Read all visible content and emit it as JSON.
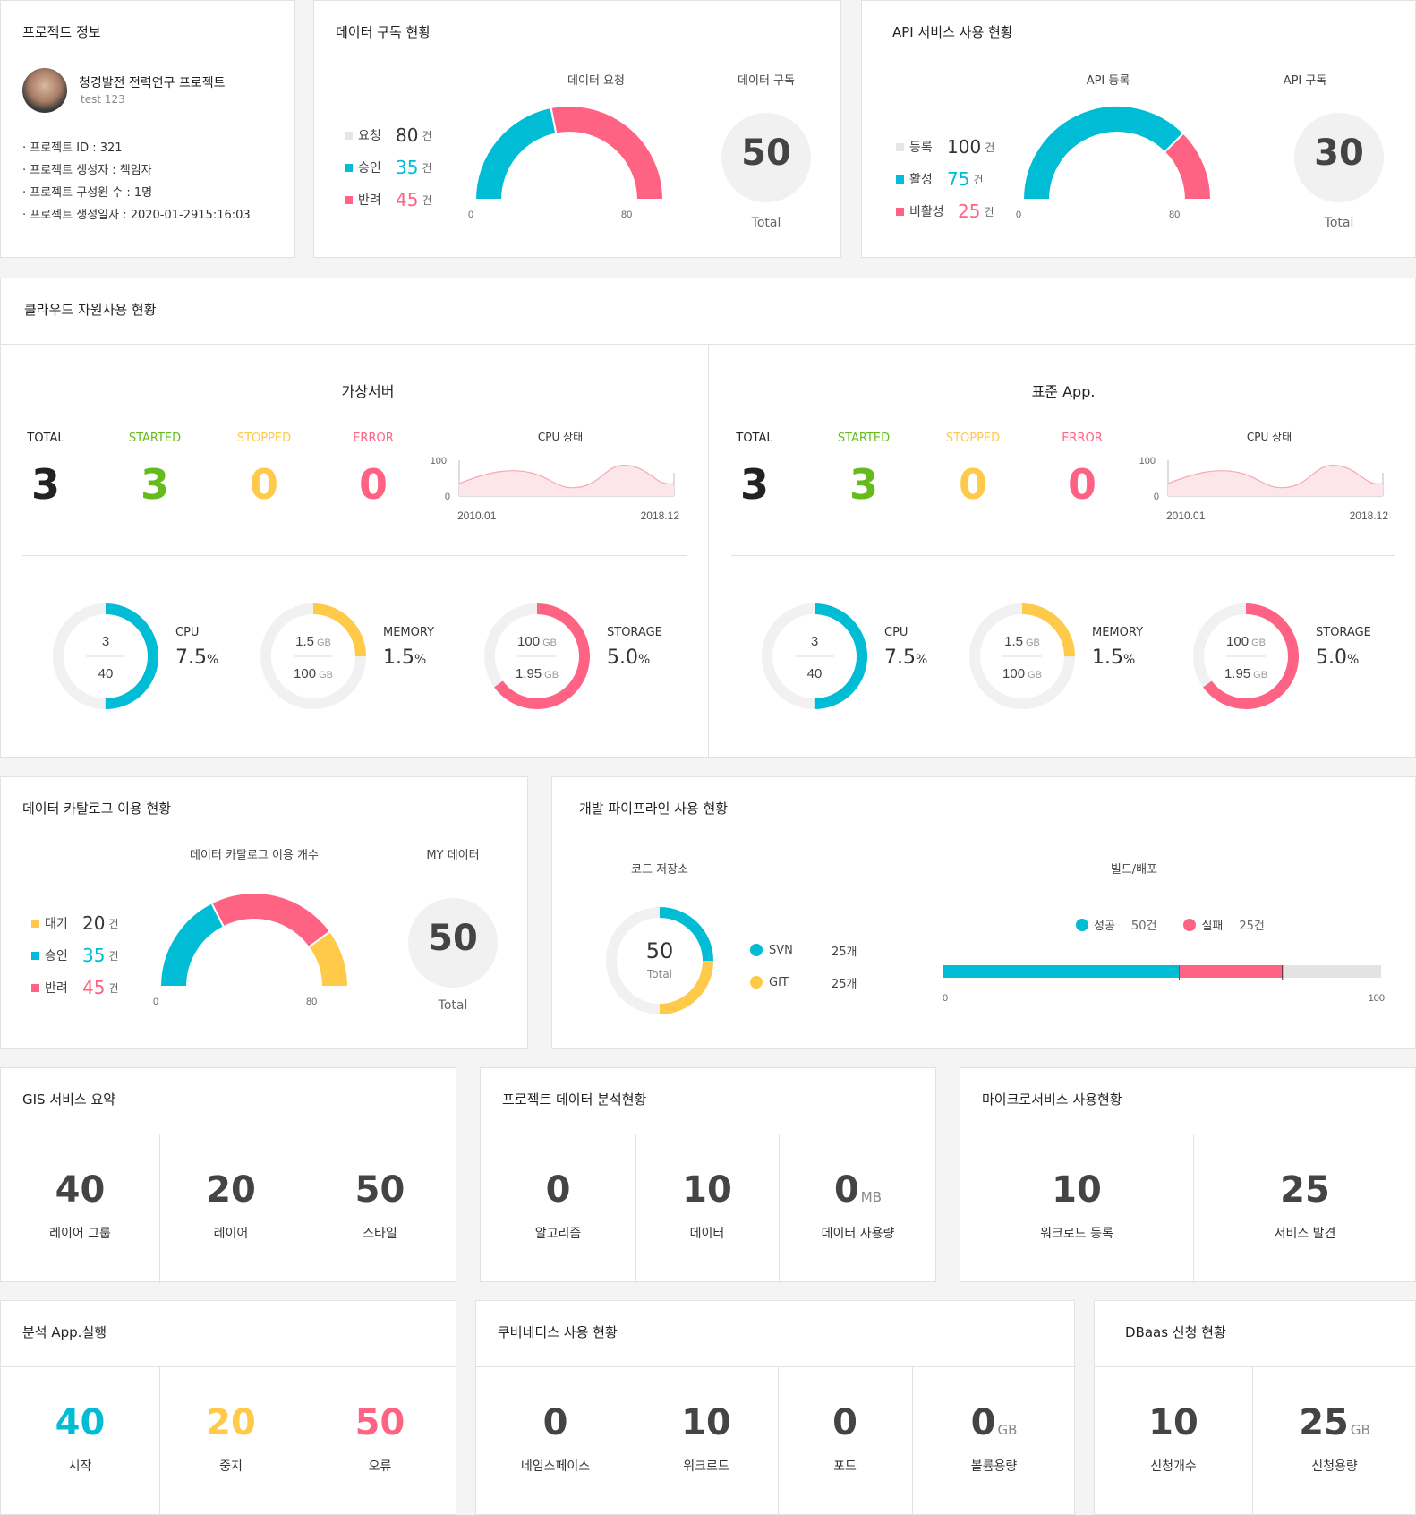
{
  "project": {
    "title": "프로젝트 정보",
    "name": "청경발전 전력연구 프로젝트",
    "sub": "test 123",
    "details": [
      "· 프로젝트 ID :  321",
      "· 프로젝트 생성자 : 책임자",
      "· 프로젝트 구성원 수 : 1명",
      "· 프로젝트 생성일자 :  2020-01-2915:16:03"
    ]
  },
  "data_sub": {
    "title": "데이터 구독 현황",
    "chart_label": "데이터 요청",
    "total_label": "데이터 구독",
    "total_value": "50",
    "total_caption": "Total",
    "legend": [
      {
        "label": "요청",
        "value": "80",
        "unit": "건",
        "color": "#e6e6e6"
      },
      {
        "label": "승인",
        "value": "35",
        "unit": "건",
        "color": "#00bcd4"
      },
      {
        "label": "반려",
        "value": "45",
        "unit": "건",
        "color": "#ff6384"
      }
    ],
    "axis_min": "0",
    "axis_max": "80"
  },
  "api": {
    "title": "API 서비스 사용 현황",
    "chart_label": "API 등록",
    "total_label": "API 구독",
    "total_value": "30",
    "total_caption": "Total",
    "legend": [
      {
        "label": "등록",
        "value": "100",
        "unit": "건",
        "color": "#e6e6e6"
      },
      {
        "label": "활성",
        "value": "75",
        "unit": "건",
        "color": "#00bcd4"
      },
      {
        "label": "비활성",
        "value": "25",
        "unit": "건",
        "color": "#ff6384"
      }
    ],
    "axis_min": "0",
    "axis_max": "80"
  },
  "cloud": {
    "title": "클라우드 자원사용 현황",
    "panels": [
      {
        "heading": "가상서버",
        "stats": [
          {
            "label": "TOTAL",
            "value": "3",
            "color": "#222222"
          },
          {
            "label": "STARTED",
            "value": "3",
            "color": "#66bb1c"
          },
          {
            "label": "STOPPED",
            "value": "0",
            "color": "#ffc94a"
          },
          {
            "label": "ERROR",
            "value": "0",
            "color": "#ff6384"
          }
        ],
        "cpu_title": "CPU 상태",
        "cpu_ymax": "100",
        "cpu_ymin": "0",
        "cpu_xstart": "2010.01",
        "cpu_xend": "2018.12",
        "gauges": [
          {
            "top": "3",
            "top_unit": "",
            "bottom": "40",
            "bottom_unit": "",
            "label": "CPU",
            "pct": "7.5",
            "pct_unit": "%",
            "color": "#00bcd4",
            "fill": 0.5
          },
          {
            "top": "1.5",
            "top_unit": "GB",
            "bottom": "100",
            "bottom_unit": "GB",
            "label": "MEMORY",
            "pct": "1.5",
            "pct_unit": "%",
            "color": "#ffc94a",
            "fill": 0.25
          },
          {
            "top": "100",
            "top_unit": "GB",
            "bottom": "1.95",
            "bottom_unit": "GB",
            "label": "STORAGE",
            "pct": "5.0",
            "pct_unit": "%",
            "color": "#ff6384",
            "fill": 0.65
          }
        ]
      },
      {
        "heading": "표준 App.",
        "stats": [
          {
            "label": "TOTAL",
            "value": "3",
            "color": "#222222"
          },
          {
            "label": "STARTED",
            "value": "3",
            "color": "#66bb1c"
          },
          {
            "label": "STOPPED",
            "value": "0",
            "color": "#ffc94a"
          },
          {
            "label": "ERROR",
            "value": "0",
            "color": "#ff6384"
          }
        ],
        "cpu_title": "CPU 상태",
        "cpu_ymax": "100",
        "cpu_ymin": "0",
        "cpu_xstart": "2010.01",
        "cpu_xend": "2018.12",
        "gauges": [
          {
            "top": "3",
            "top_unit": "",
            "bottom": "40",
            "bottom_unit": "",
            "label": "CPU",
            "pct": "7.5",
            "pct_unit": "%",
            "color": "#00bcd4",
            "fill": 0.5
          },
          {
            "top": "1.5",
            "top_unit": "GB",
            "bottom": "100",
            "bottom_unit": "GB",
            "label": "MEMORY",
            "pct": "1.5",
            "pct_unit": "%",
            "color": "#ffc94a",
            "fill": 0.25
          },
          {
            "top": "100",
            "top_unit": "GB",
            "bottom": "1.95",
            "bottom_unit": "GB",
            "label": "STORAGE",
            "pct": "5.0",
            "pct_unit": "%",
            "color": "#ff6384",
            "fill": 0.65
          }
        ]
      }
    ]
  },
  "catalog": {
    "title": "데이터 카탈로그 이용 현황",
    "chart_label": "데이터 카탈로그 이용 개수",
    "total_label": "MY 데이터",
    "total_value": "50",
    "total_caption": "Total",
    "legend": [
      {
        "label": "대기",
        "value": "20",
        "unit": "건",
        "color": "#ffc94a"
      },
      {
        "label": "승인",
        "value": "35",
        "unit": "건",
        "color": "#00bcd4"
      },
      {
        "label": "반려",
        "value": "45",
        "unit": "건",
        "color": "#ff6384"
      }
    ],
    "axis_min": "0",
    "axis_max": "80"
  },
  "pipeline": {
    "title": "개발 파이프라인 사용 현황",
    "code_label": "코드 저장소",
    "code_total": "50",
    "code_total_caption": "Total",
    "code_legend": [
      {
        "label": "SVN",
        "value": "25개",
        "color": "#00bcd4"
      },
      {
        "label": "GIT",
        "value": "25개",
        "color": "#ffc94a"
      }
    ],
    "build_label": "빌드/배포",
    "build_legend": [
      {
        "label": "성공",
        "value": "50건",
        "color": "#00bcd4"
      },
      {
        "label": "실패",
        "value": "25건",
        "color": "#ff6384"
      }
    ],
    "build_axis_min": "0",
    "build_axis_max": "100"
  },
  "gis": {
    "title": "GIS 서비스 요약",
    "tiles": [
      {
        "value": "40",
        "unit": "",
        "label": "레이어 그룹"
      },
      {
        "value": "20",
        "unit": "",
        "label": "레이어"
      },
      {
        "value": "50",
        "unit": "",
        "label": "스타일"
      }
    ]
  },
  "analysis": {
    "title": "프로젝트 데이터 분석현황",
    "tiles": [
      {
        "value": "0",
        "unit": "",
        "label": "알고리즘"
      },
      {
        "value": "10",
        "unit": "",
        "label": "데이터"
      },
      {
        "value": "0",
        "unit": "MB",
        "label": "데이터 사용량"
      }
    ]
  },
  "micro": {
    "title": "마이크로서비스 사용현황",
    "tiles": [
      {
        "value": "10",
        "unit": "",
        "label": "워크로드 등록"
      },
      {
        "value": "25",
        "unit": "",
        "label": "서비스 발견"
      }
    ]
  },
  "app_run": {
    "title": "분석 App.실행",
    "tiles": [
      {
        "value": "40",
        "unit": "",
        "label": "시작",
        "color": "#00bcd4"
      },
      {
        "value": "20",
        "unit": "",
        "label": "중지",
        "color": "#ffc94a"
      },
      {
        "value": "50",
        "unit": "",
        "label": "오류",
        "color": "#ff6384"
      }
    ]
  },
  "kube": {
    "title": "쿠버네티스 사용 현황",
    "tiles": [
      {
        "value": "0",
        "unit": "",
        "label": "네임스페이스"
      },
      {
        "value": "10",
        "unit": "",
        "label": "워크로드"
      },
      {
        "value": "0",
        "unit": "",
        "label": "포드"
      },
      {
        "value": "0",
        "unit": "GB",
        "label": "볼륨용량"
      }
    ]
  },
  "dbaas": {
    "title": "DBaas 신청 현황",
    "tiles": [
      {
        "value": "10",
        "unit": "",
        "label": "신청개수"
      },
      {
        "value": "25",
        "unit": "GB",
        "label": "신청용량"
      }
    ]
  }
}
